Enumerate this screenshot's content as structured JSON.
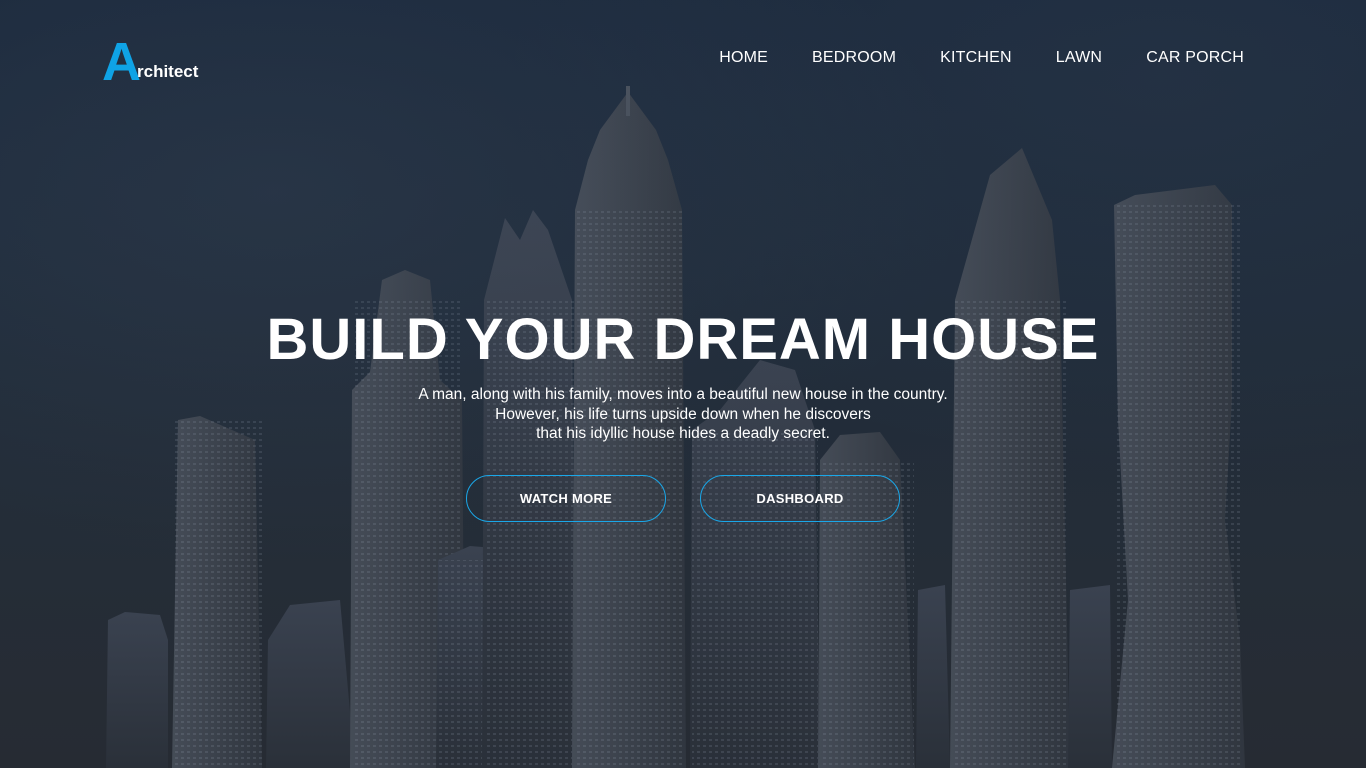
{
  "brand": {
    "logo_letter": "A",
    "logo_rest": "rchitect",
    "accent_color": "#0fa3e6"
  },
  "nav": {
    "items": [
      {
        "label": "HOME"
      },
      {
        "label": "BEDROOM"
      },
      {
        "label": "KITCHEN"
      },
      {
        "label": "LAWN"
      },
      {
        "label": "CAR PORCH"
      }
    ]
  },
  "hero": {
    "title": "BUILD YOUR DREAM HOUSE",
    "description_lines": [
      "A man, along with his family, moves into a beautiful new house in the country.",
      "However, his life turns upside down when he discovers",
      "that his idyllic house hides a deadly secret."
    ],
    "buttons": {
      "watch_more": "WATCH MORE",
      "dashboard": "DASHBOARD"
    },
    "button_border_color": "#1aa7e8"
  }
}
